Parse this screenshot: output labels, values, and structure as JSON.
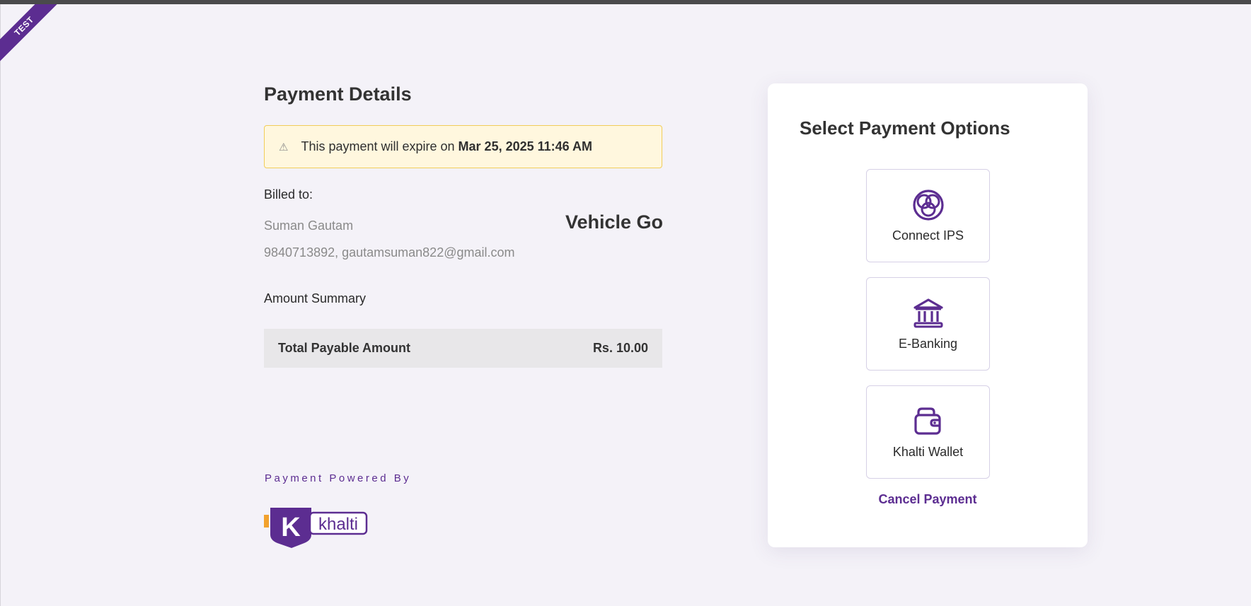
{
  "ribbon": "TEST",
  "payment_details": {
    "title": "Payment Details",
    "notice_prefix": "This payment will expire on",
    "expiry": "Mar 25, 2025 11:46 AM",
    "billed_label": "Billed to:",
    "customer_name": "Suman Gautam",
    "merchant": "Vehicle Go",
    "contact": "9840713892, gautamsuman822@gmail.com",
    "summary_label": "Amount Summary",
    "total_label": "Total Payable Amount",
    "total_value": "Rs. 10.00"
  },
  "footer": {
    "powered_by": "Payment Powered By",
    "logo_text": "khalti",
    "logo_letter": "K"
  },
  "options_panel": {
    "title": "Select Payment Options",
    "options": [
      {
        "label": "Connect IPS",
        "icon": "connect-ips-icon"
      },
      {
        "label": "E-Banking",
        "icon": "bank-icon"
      },
      {
        "label": "Khalti Wallet",
        "icon": "wallet-icon"
      }
    ],
    "cancel_label": "Cancel Payment"
  },
  "colors": {
    "brand": "#5c2d91",
    "accent_orange": "#f2a22d",
    "notice_bg": "#fff7de",
    "notice_border": "#f1cd59"
  }
}
